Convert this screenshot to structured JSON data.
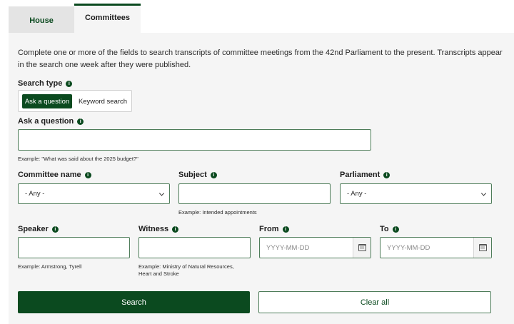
{
  "tabs": [
    {
      "label": "House",
      "active": false
    },
    {
      "label": "Committees",
      "active": true
    }
  ],
  "intro_text": "Complete one or more of the fields to search transcripts of committee meetings from the 42nd Parliament to the present. Transcripts appear in the search one week after they were published.",
  "search_type": {
    "label": "Search type",
    "options": [
      "Ask a question",
      "Keyword search"
    ],
    "selected": "Ask a question"
  },
  "ask_question": {
    "label": "Ask a question",
    "value": "",
    "example": "Example: \"What was said about the 2025 budget?\""
  },
  "committee_name": {
    "label": "Committee name",
    "selected": "- Any -"
  },
  "subject": {
    "label": "Subject",
    "value": "",
    "example": "Example: Intended appointments"
  },
  "parliament": {
    "label": "Parliament",
    "selected": "- Any -"
  },
  "speaker": {
    "label": "Speaker",
    "value": "",
    "example": "Example: Armstrong, Tyrell"
  },
  "witness": {
    "label": "Witness",
    "value": "",
    "example_line1": "Example: Ministry of Natural Resources,",
    "example_line2": "Heart and Stroke"
  },
  "date_from": {
    "label": "From",
    "placeholder": "YYYY-MM-DD"
  },
  "date_to": {
    "label": "To",
    "placeholder": "YYYY-MM-DD"
  },
  "buttons": {
    "search": "Search",
    "clear": "Clear all"
  },
  "info_glyph": "i",
  "colors": {
    "accent": "#0b4a1f",
    "panel_bg": "#f5f5f5",
    "tab_inactive_bg": "#e4e4e4"
  }
}
